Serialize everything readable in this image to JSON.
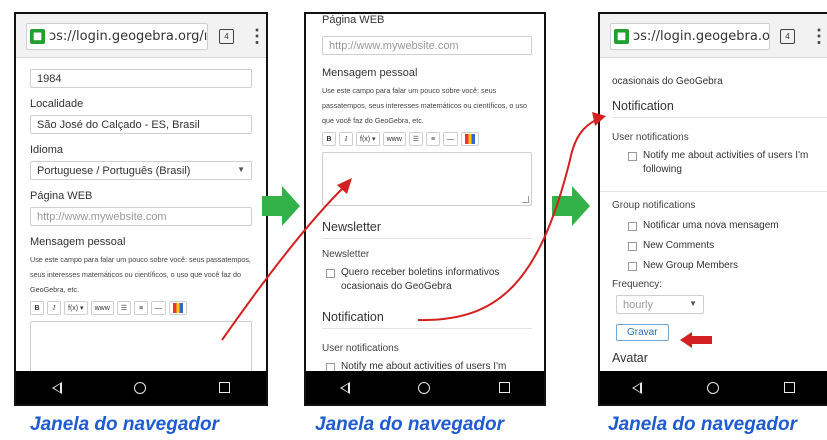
{
  "browser": {
    "url": "ɔs://login.geogebra.org/ı"
  },
  "colors": {
    "caption": "#1f5bd1",
    "annotation_arrow": "#d42020",
    "step_arrow": "#33b24a"
  },
  "icons": [
    "lock-icon",
    "tabs-icon",
    "overflow-menu-icon",
    "back-icon",
    "home-icon",
    "recents-icon",
    "next-step-arrow-icon",
    "annotation-arrow-icon"
  ],
  "phone1": {
    "year": "1984",
    "localidade_label": "Localidade",
    "localidade_value": "São José do Calçado - ES, Brasil",
    "idioma_label": "Idioma",
    "idioma_value": "Portuguese / Português (Brasil)",
    "webpage_label": "Página WEB",
    "webpage_placeholder": "http://www.mywebsite.com",
    "message_label": "Mensagem pessoal",
    "help_text": "Use este campo para falar um pouco sobre você: seus passatempos, seus interesses matemáticos ou científicos, o uso que você faz do GeoGebra, etc."
  },
  "phone2": {
    "webpage_label": "Página WEB",
    "webpage_placeholder": "http://www.mywebsite.com",
    "message_label": "Mensagem pessoal",
    "help_text": "Use este campo para falar um pouco sobre você: seus passatempos, seus interesses matemáticos ou científicos, o uso que você faz do GeoGebra, etc.",
    "newsletter_heading": "Newsletter",
    "newsletter_label": "Newsletter",
    "newsletter_option": "Quero receber boletins informativos ocasionais do GeoGebra",
    "notification_heading": "Notification",
    "user_notifications_label": "User notifications",
    "notify_option": "Notify me about activities of users I'm"
  },
  "phone3": {
    "top_text": "ocasionais do GeoGebra",
    "notification_heading": "Notification",
    "user_notifications_label": "User notifications",
    "notify_option": "Notify me about activities of users I'm following",
    "group_notifications_label": "Group notifications",
    "group_options": [
      "Notificar uma nova mensagem",
      "New Comments",
      "New Group Members"
    ],
    "frequency_label": "Frequency:",
    "frequency_value": "hourly",
    "save_button": "Gravar",
    "avatar_heading": "Avatar"
  },
  "toolbar": {
    "bold": "B",
    "italic": "I",
    "formula": "f(x) ▾",
    "link": "www",
    "ul": "☰",
    "ol": "≡",
    "hr": "—"
  },
  "captions": [
    "Janela do navegador",
    "Janela do navegador",
    "Janela do navegador"
  ]
}
